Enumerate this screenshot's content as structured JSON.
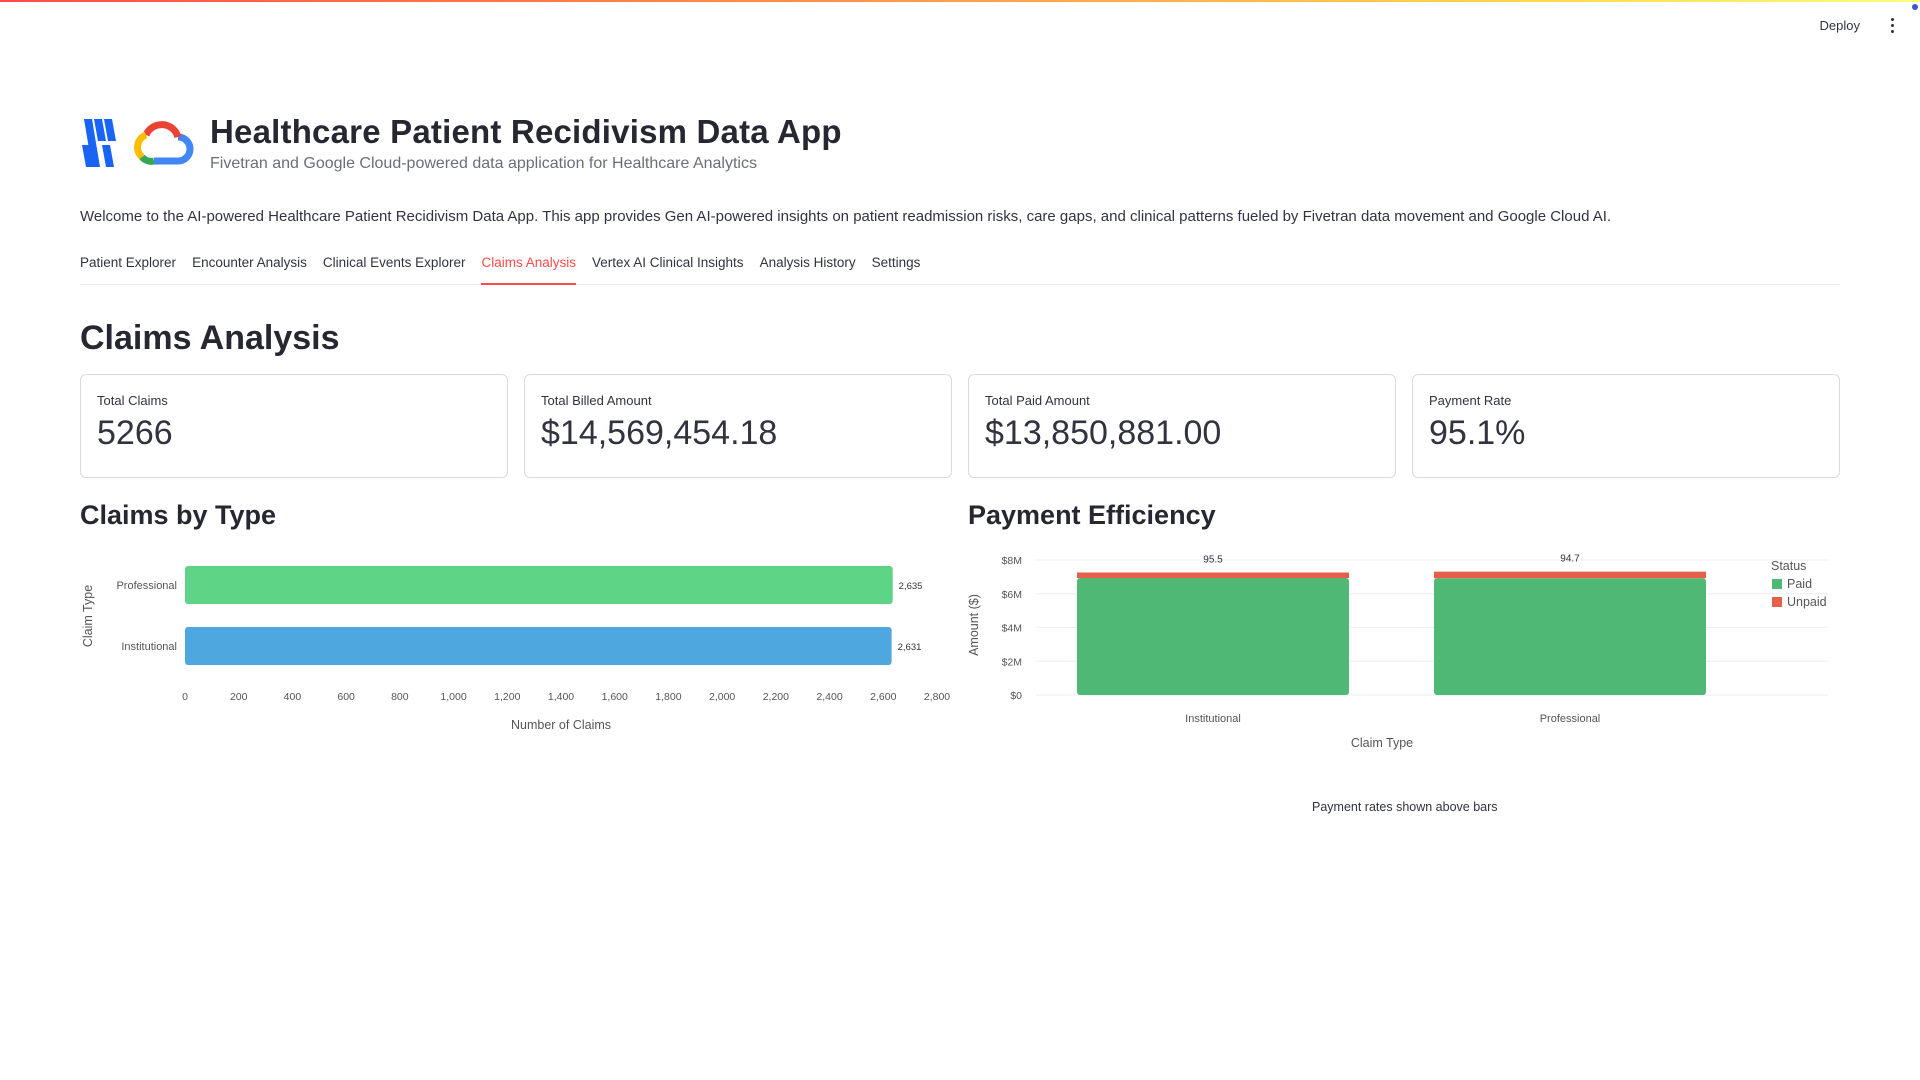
{
  "topbar": {
    "deploy_label": "Deploy",
    "menu_icon": "kebab-menu-icon"
  },
  "header": {
    "title": "Healthcare Patient Recidivism Data App",
    "subtitle": "Fivetran and Google Cloud-powered data application for Healthcare Analytics",
    "logos": [
      "fivetran-logo",
      "google-cloud-logo"
    ]
  },
  "welcome_text": "Welcome to the AI-powered Healthcare Patient Recidivism Data App. This app provides Gen AI-powered insights on patient readmission risks, care gaps, and clinical patterns fueled by Fivetran data movement and Google Cloud AI.",
  "tabs": [
    {
      "label": "Patient Explorer",
      "active": false
    },
    {
      "label": "Encounter Analysis",
      "active": false
    },
    {
      "label": "Clinical Events Explorer",
      "active": false
    },
    {
      "label": "Claims Analysis",
      "active": true
    },
    {
      "label": "Vertex AI Clinical Insights",
      "active": false
    },
    {
      "label": "Analysis History",
      "active": false
    },
    {
      "label": "Settings",
      "active": false
    }
  ],
  "section_title": "Claims Analysis",
  "metrics": [
    {
      "label": "Total Claims",
      "value": "5266"
    },
    {
      "label": "Total Billed Amount",
      "value": "$14,569,454.18"
    },
    {
      "label": "Total Paid Amount",
      "value": "$13,850,881.00"
    },
    {
      "label": "Payment Rate",
      "value": "95.1%"
    }
  ],
  "chart_data": [
    {
      "type": "bar",
      "orientation": "horizontal",
      "title": "Claims by Type",
      "categories": [
        "Professional",
        "Institutional"
      ],
      "values": [
        2635,
        2631
      ],
      "value_labels": [
        "2,635",
        "2,631"
      ],
      "colors": [
        "#5dd486",
        "#4fa7e0"
      ],
      "xlabel": "Number of Claims",
      "ylabel": "Claim Type",
      "xlim": [
        0,
        2800
      ],
      "xticks": [
        0,
        200,
        400,
        600,
        800,
        1000,
        1200,
        1400,
        1600,
        1800,
        2000,
        2200,
        2400,
        2600,
        2800
      ],
      "xtick_labels": [
        "0",
        "200",
        "400",
        "600",
        "800",
        "1,000",
        "1,200",
        "1,400",
        "1,600",
        "1,800",
        "2,000",
        "2,200",
        "2,400",
        "2,600",
        "2,800"
      ],
      "grid": false
    },
    {
      "type": "bar",
      "stacked": true,
      "title": "Payment Efficiency",
      "categories": [
        "Institutional",
        "Professional"
      ],
      "series": [
        {
          "name": "Paid",
          "values": [
            6.93,
            6.92
          ],
          "color": "#4fb874"
        },
        {
          "name": "Unpaid",
          "values": [
            0.33,
            0.39
          ],
          "color": "#e5604b"
        }
      ],
      "annotations": [
        "95.5",
        "94.7"
      ],
      "xlabel": "Claim Type",
      "ylabel": "Amount ($)",
      "ylim": [
        0,
        8
      ],
      "yticks": [
        0,
        2,
        4,
        6,
        8
      ],
      "ytick_labels": [
        "$0",
        "$2M",
        "$4M",
        "$6M",
        "$8M"
      ],
      "legend_title": "Status",
      "legend_position": "right",
      "grid": true,
      "caption": "Payment rates shown above bars"
    }
  ]
}
